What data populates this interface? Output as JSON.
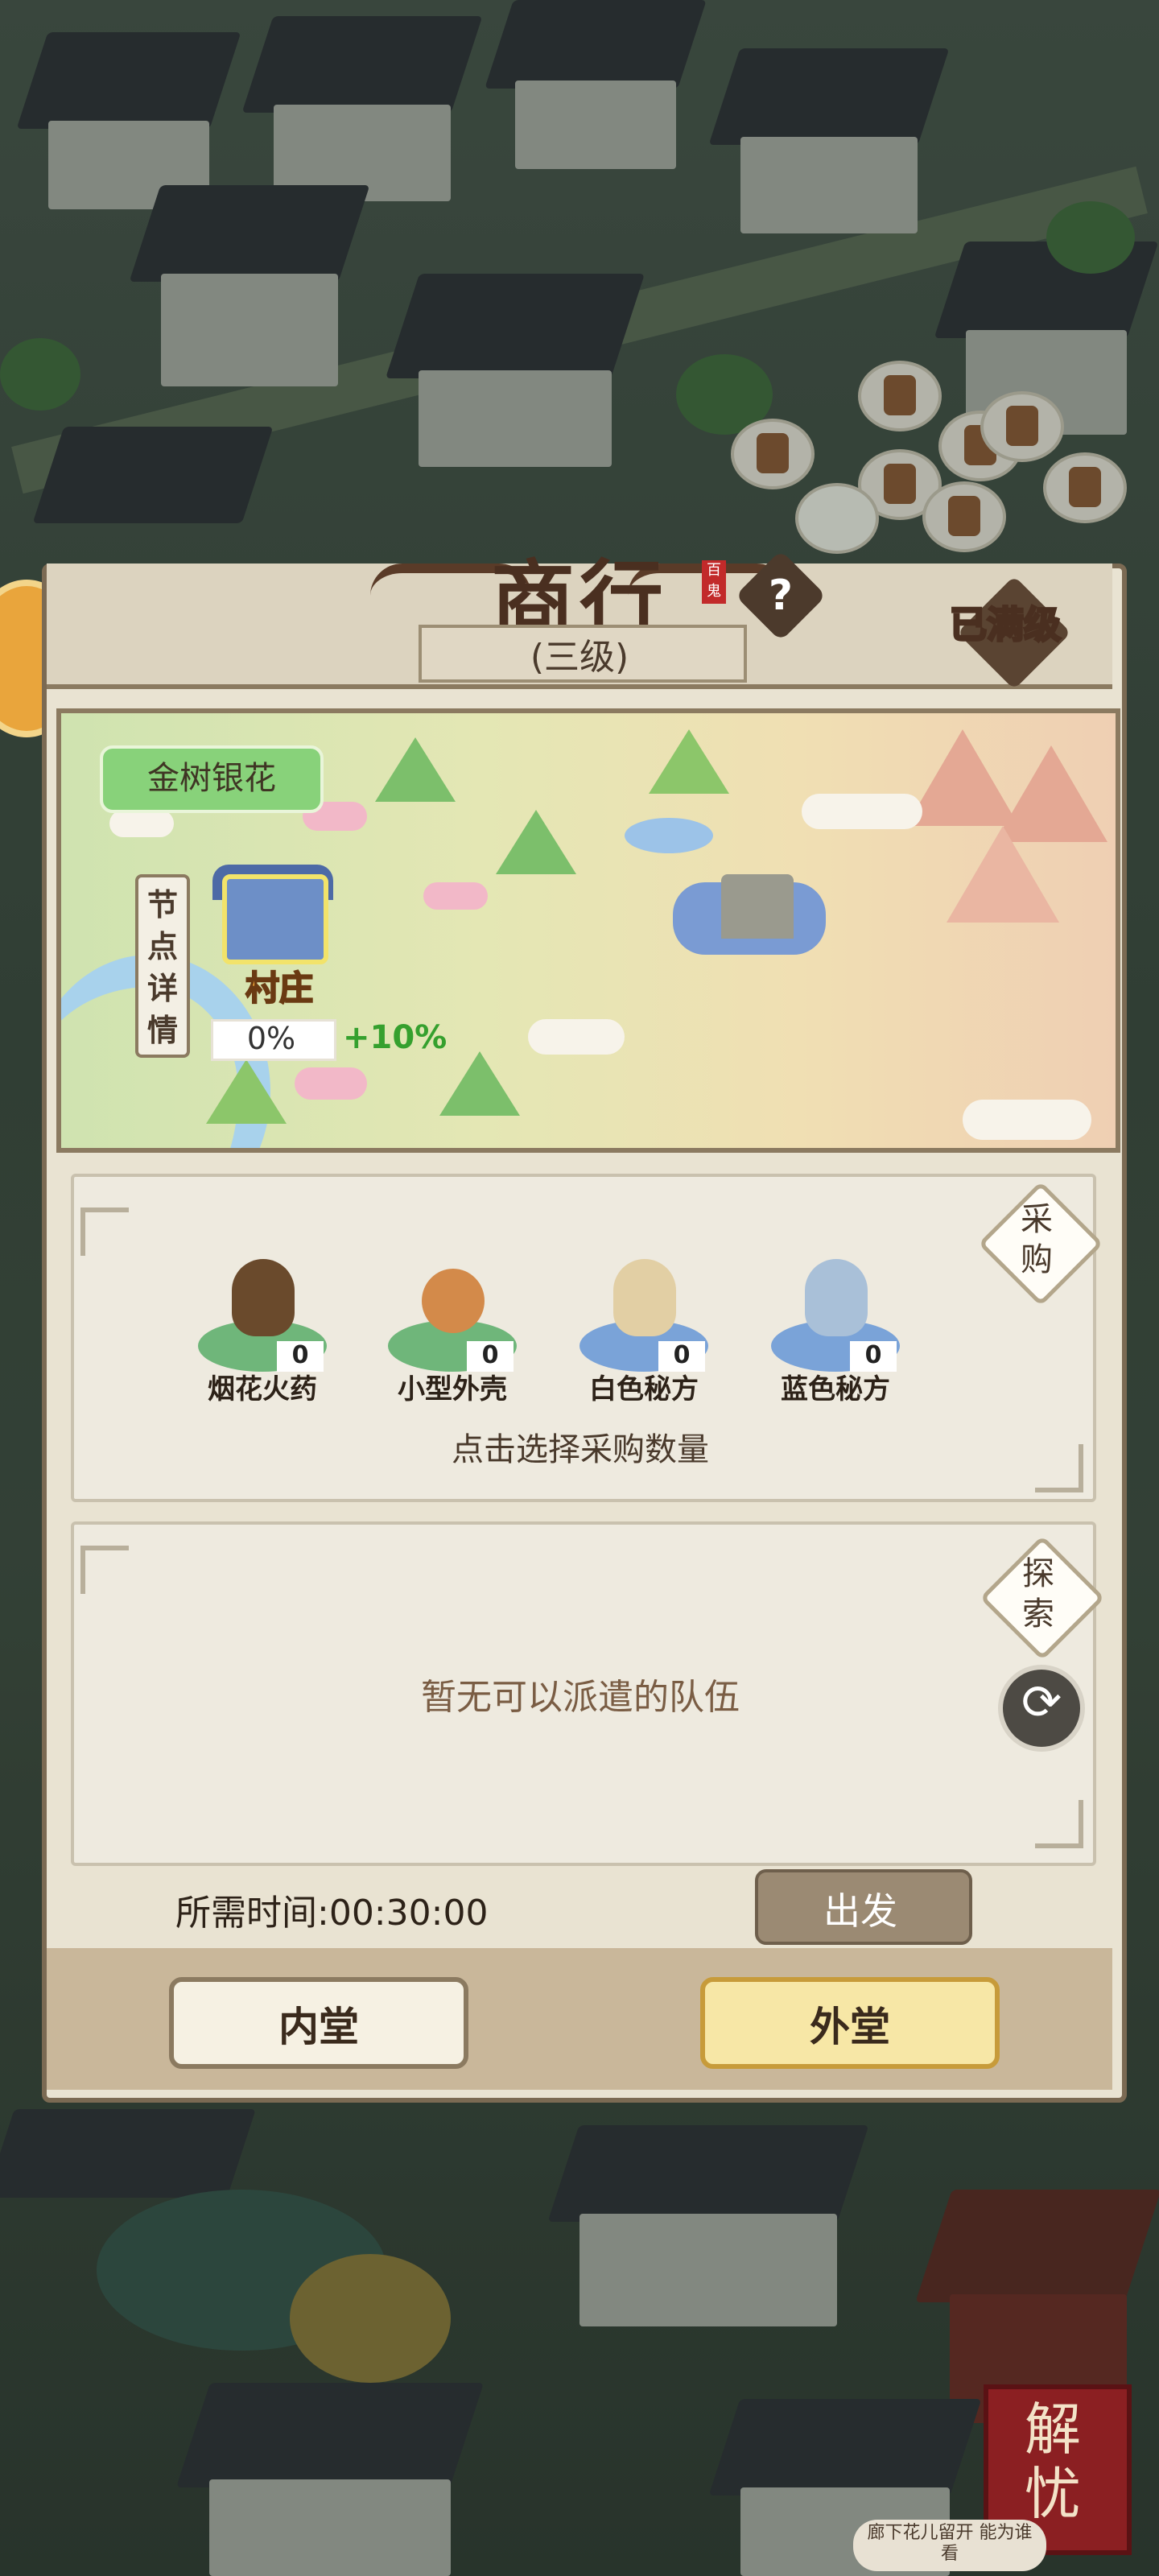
{
  "building": {
    "title": "商行",
    "seal_text": "百鬼",
    "level": "(三级)",
    "help_icon": "question-mark-icon",
    "max_level_label": "已满级"
  },
  "map": {
    "route_name": "金树银花",
    "node_detail_label": "节点详情",
    "node_detail_chars": [
      "节",
      "点",
      "详",
      "情"
    ],
    "node": {
      "name": "村庄",
      "icon": "village-icon",
      "progress": "0%",
      "bonus": "+10%"
    }
  },
  "purchase": {
    "button_label": "采购",
    "button_chars": [
      "采",
      "购"
    ],
    "items": [
      {
        "name": "烟花火药",
        "count": "0",
        "icon": "gunpowder-jar-icon",
        "pad_color": "#6fb67a",
        "icon_color": "#6a4a2c"
      },
      {
        "name": "小型外壳",
        "count": "0",
        "icon": "small-shell-icon",
        "pad_color": "#6fb67a",
        "icon_color": "#d38a4a"
      },
      {
        "name": "白色秘方",
        "count": "0",
        "icon": "white-recipe-bag-icon",
        "pad_color": "#7aa3d8",
        "icon_color": "#e2cfa4"
      },
      {
        "name": "蓝色秘方",
        "count": "0",
        "icon": "blue-recipe-bag-icon",
        "pad_color": "#7aa3d8",
        "icon_color": "#a9c0d8"
      }
    ],
    "hint": "点击选择采购数量"
  },
  "explore": {
    "button_label": "探索",
    "button_chars": [
      "探",
      "索"
    ],
    "empty_text": "暂无可以派遣的队伍",
    "refresh_icon": "refresh-icon"
  },
  "dispatch": {
    "time_label": "所需时间:00:30:00",
    "go_label": "出发"
  },
  "tabs": {
    "inner": "内堂",
    "outer": "外堂",
    "active": "outer"
  },
  "corner_logo": {
    "text": "解忧",
    "chars": [
      "解",
      "忧"
    ]
  },
  "ticker": {
    "text": "廊下花儿留开 能为谁看"
  },
  "colors": {
    "panel_bg": "#e9e3d2",
    "title_brown": "#4a2f20",
    "bonus_green": "#35a02e",
    "village_orange": "#f2a93b",
    "active_tab": "#f7e7a6"
  }
}
